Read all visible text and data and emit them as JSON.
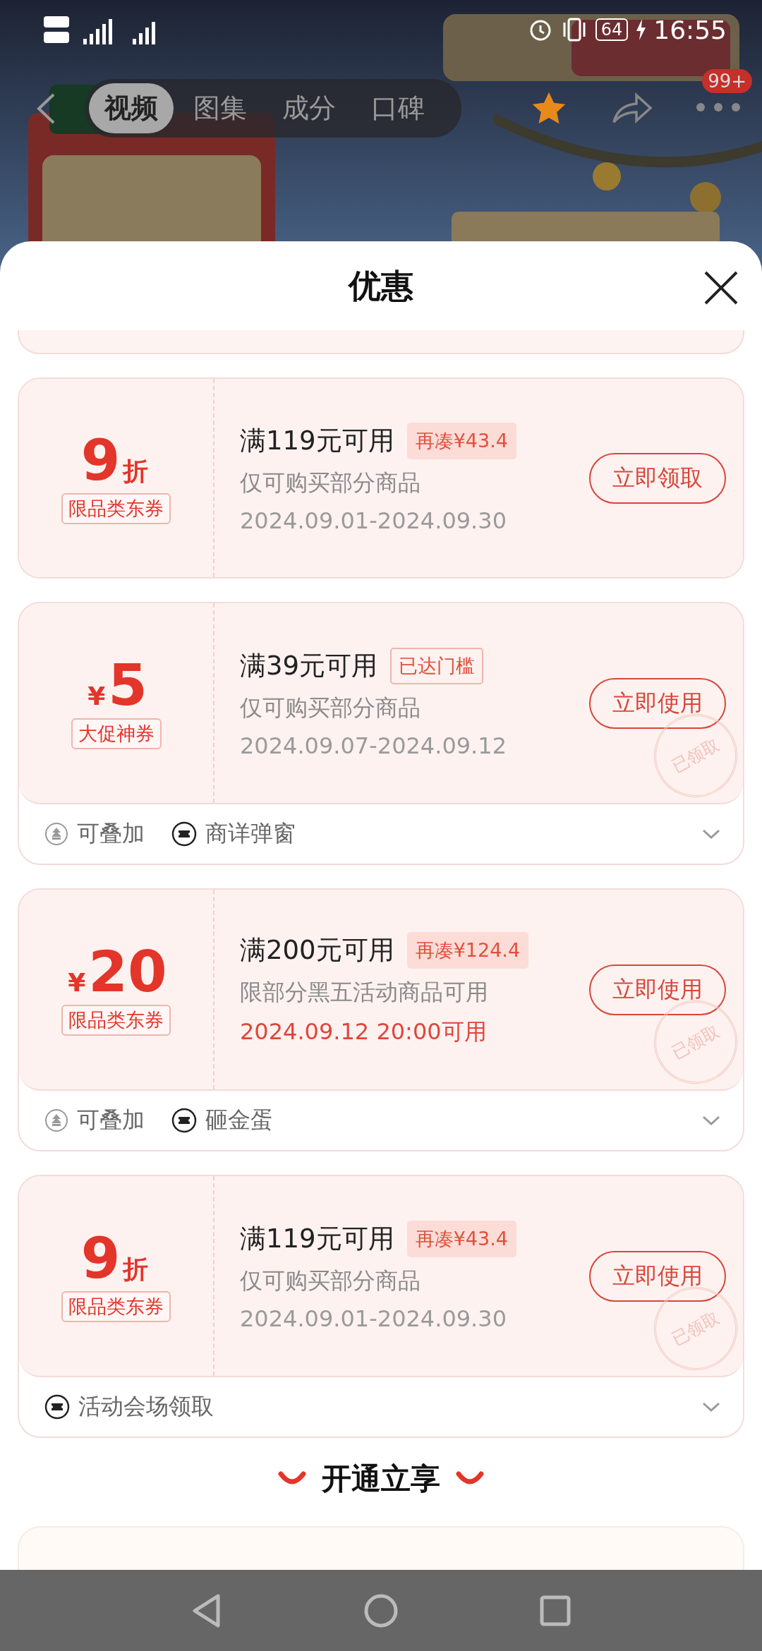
{
  "status_bar": {
    "battery": "64",
    "time": "16:55"
  },
  "nav": {
    "tabs": [
      {
        "label": "视频",
        "selected": true
      },
      {
        "label": "图集",
        "selected": false
      },
      {
        "label": "成分",
        "selected": false
      },
      {
        "label": "口碑",
        "selected": false
      }
    ],
    "badge": "99+"
  },
  "sheet": {
    "title": "优惠",
    "coupons": [
      {
        "kind": "discount",
        "value": "9",
        "unit": "折",
        "tag": "限品类东券",
        "condition": "满119元可用",
        "badge": {
          "kind": "shortfall",
          "text": "再凑¥43.4"
        },
        "description": "仅可购买部分商品",
        "validity": {
          "text": "2024.09.01-2024.09.30",
          "highlight": false
        },
        "button": "立即领取",
        "claimed": false
      },
      {
        "kind": "cash",
        "currency": "¥",
        "value": "5",
        "tag": "大促神券",
        "condition": "满39元可用",
        "badge": {
          "kind": "reached",
          "text": "已达门槛"
        },
        "description": "仅可购买部分商品",
        "validity": {
          "text": "2024.09.07-2024.09.12",
          "highlight": false
        },
        "button": "立即使用",
        "claimed": true,
        "stamp": "已领取",
        "footer": {
          "expanded": false,
          "items": [
            {
              "kind": "stack",
              "text": "可叠加"
            },
            {
              "kind": "ticket",
              "text": "商详弹窗"
            }
          ]
        }
      },
      {
        "kind": "cash",
        "currency": "¥",
        "value": "20",
        "tag": "限品类东券",
        "condition": "满200元可用",
        "badge": {
          "kind": "shortfall",
          "text": "再凑¥124.4"
        },
        "description": "限部分黑五活动商品可用",
        "validity": {
          "text": "2024.09.12 20:00可用",
          "highlight": true
        },
        "button": "立即使用",
        "claimed": true,
        "stamp": "已领取",
        "footer": {
          "expanded": false,
          "items": [
            {
              "kind": "stack",
              "text": "可叠加"
            },
            {
              "kind": "ticket",
              "text": "砸金蛋"
            }
          ]
        }
      },
      {
        "kind": "discount",
        "value": "9",
        "unit": "折",
        "tag": "限品类东券",
        "condition": "满119元可用",
        "badge": {
          "kind": "shortfall",
          "text": "再凑¥43.4"
        },
        "description": "仅可购买部分商品",
        "validity": {
          "text": "2024.09.01-2024.09.30",
          "highlight": false
        },
        "button": "立即使用",
        "claimed": true,
        "stamp": "已领取",
        "footer": {
          "expanded": false,
          "items": [
            {
              "kind": "ticket",
              "text": "活动会场领取"
            }
          ]
        }
      }
    ],
    "section_heading": "开通立享"
  }
}
